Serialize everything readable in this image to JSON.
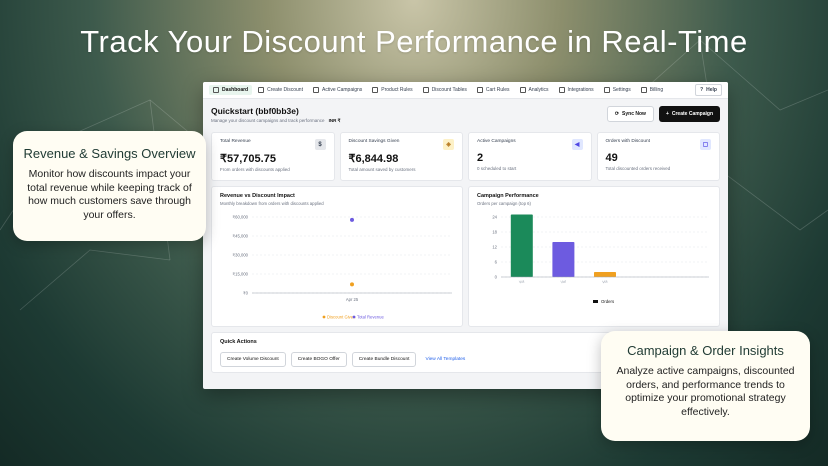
{
  "hero": {
    "title": "Track Your Discount Performance in Real-Time"
  },
  "colors": {
    "brand": "#1b8a5a",
    "orders_bar": "#1b8a5a",
    "purple": "#6d5be0",
    "orange": "#f0a020",
    "text_dark": "#111111"
  },
  "nav": {
    "items": [
      {
        "label": "Dashboard",
        "icon": "dashboard-icon",
        "active": true
      },
      {
        "label": "Create Discount",
        "icon": "plus-circle-icon"
      },
      {
        "label": "Active Campaigns",
        "icon": "list-icon"
      },
      {
        "label": "Product Rules",
        "icon": "tag-icon"
      },
      {
        "label": "Discount Tables",
        "icon": "table-icon"
      },
      {
        "label": "Cart Rules",
        "icon": "cart-icon"
      },
      {
        "label": "Analytics",
        "icon": "chart-icon"
      },
      {
        "label": "Integrations",
        "icon": "integrations-icon"
      },
      {
        "label": "Settings",
        "icon": "gear-icon"
      },
      {
        "label": "Billing",
        "icon": "billing-icon"
      }
    ],
    "help": "Help"
  },
  "header": {
    "title": "Quickstart (bbf0bb3e)",
    "subtitle": "Manage your discount campaigns and track performance",
    "currency": "INR ₹",
    "sync_label": "Sync Now",
    "create_label": "Create Campaign"
  },
  "stats": [
    {
      "label": "Total Revenue",
      "value": "₹57,705.75",
      "sub": "From orders with discounts applied",
      "icon": "dollar-icon",
      "glyph": "$",
      "icon_bg": "#e5e7eb",
      "icon_color": "#374151"
    },
    {
      "label": "Discount Savings Given",
      "value": "₹6,844.98",
      "sub": "Total amount saved by customers",
      "icon": "tag-icon",
      "glyph": "◈",
      "icon_bg": "#fdf1c7",
      "icon_color": "#b7791f"
    },
    {
      "label": "Active Campaigns",
      "value": "2",
      "sub": "0 scheduled to start",
      "icon": "megaphone-icon",
      "glyph": "◀",
      "icon_bg": "#e0e7ff",
      "icon_color": "#4f46e5"
    },
    {
      "label": "Orders with Discount",
      "value": "49",
      "sub": "Total discounted orders received",
      "icon": "bag-icon",
      "glyph": "▢",
      "icon_bg": "#e0e7ff",
      "icon_color": "#4f46e5"
    }
  ],
  "revenue_chart": {
    "title": "Revenue vs Discount Impact",
    "subtitle": "Monthly breakdown from orders with discounts applied"
  },
  "campaign_chart": {
    "title": "Campaign Performance",
    "subtitle": "Orders per campaign (top 6)"
  },
  "chart_data": [
    {
      "type": "scatter",
      "title": "Revenue vs Discount Impact",
      "x": [
        "Apr 25"
      ],
      "yticks": [
        "₹60,000",
        "₹45,000",
        "₹30,000",
        "₹15,000",
        "₹0"
      ],
      "ylim": [
        0,
        60000
      ],
      "series": [
        {
          "name": "Discount Given",
          "color": "#f0a020",
          "values": [
            6844.98
          ]
        },
        {
          "name": "Total Revenue",
          "color": "#6d5be0",
          "values": [
            57705.75
          ]
        }
      ],
      "grid": true,
      "legend": "bottom-center"
    },
    {
      "type": "bar",
      "title": "Campaign Performance",
      "categories": [
        "Vol",
        "Vol",
        "Vol",
        "",
        ""
      ],
      "values": [
        25,
        14,
        2,
        0,
        0
      ],
      "colors": [
        "#1b8a5a",
        "#6d5be0",
        "#f0a020",
        "#1b8a5a",
        "#1b8a5a"
      ],
      "yticks": [
        24,
        18,
        12,
        6,
        0
      ],
      "ylim": [
        0,
        24
      ],
      "series": [
        {
          "name": "Orders",
          "values": [
            25,
            14,
            2,
            0,
            0
          ]
        }
      ],
      "grid": true,
      "legend": "bottom-center"
    }
  ],
  "quick_actions": {
    "title": "Quick Actions",
    "buttons": [
      "Create Volume Discount",
      "Create BOGO Offer",
      "Create Bundle Discount"
    ],
    "link": "View All Templates"
  },
  "callouts": {
    "left": {
      "title": "Revenue & Savings Overview",
      "text": "Monitor how discounts impact your total revenue while keeping track of how much customers save through your offers."
    },
    "right": {
      "title": "Campaign & Order Insights",
      "text": "Analyze active campaigns, discounted orders, and performance trends to optimize your promotional strategy effectively."
    }
  }
}
